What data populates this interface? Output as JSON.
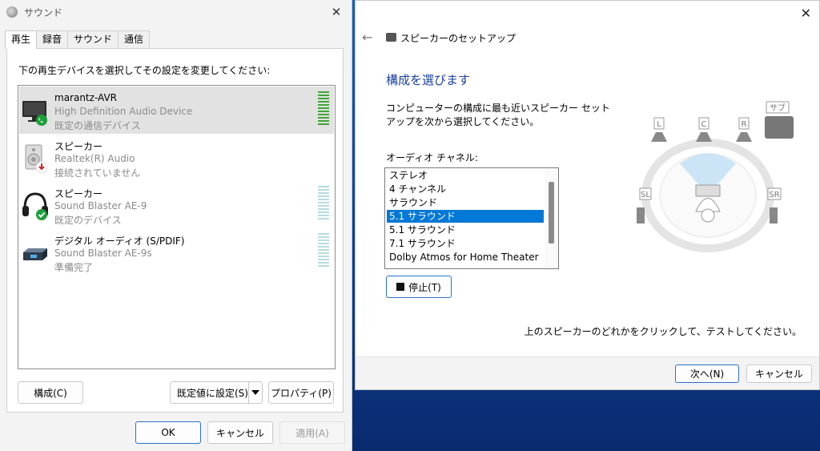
{
  "sound": {
    "title": "サウンド",
    "tabs": [
      "再生",
      "録音",
      "サウンド",
      "通信"
    ],
    "instruction": "下の再生デバイスを選択してその設定を変更してください:",
    "devices": [
      {
        "name": "marantz-AVR",
        "desc": "High Definition Audio Device",
        "status": "既定の通信デバイス"
      },
      {
        "name": "スピーカー",
        "desc": "Realtek(R) Audio",
        "status": "接続されていません"
      },
      {
        "name": "スピーカー",
        "desc": "Sound Blaster AE-9",
        "status": "既定のデバイス"
      },
      {
        "name": "デジタル オーディオ (S/PDIF)",
        "desc": "Sound Blaster AE-9s",
        "status": "準備完了"
      }
    ],
    "buttons": {
      "configure": "構成(C)",
      "set_default": "既定値に設定(S)",
      "properties": "プロパティ(P)",
      "ok": "OK",
      "cancel": "キャンセル",
      "apply": "適用(A)"
    }
  },
  "setup": {
    "title": "スピーカーのセットアップ",
    "heading": "構成を選びます",
    "description": "コンピューターの構成に最も近いスピーカー セットアップを次から選択してください。",
    "channel_label": "オーディオ チャネル:",
    "channels": [
      "ステレオ",
      "4 チャンネル",
      "サラウンド",
      "5.1 サラウンド",
      "5.1 サラウンド",
      "7.1 サラウンド",
      "Dolby Atmos for Home Theater"
    ],
    "selected_channel_index": 3,
    "stop_label": "停止(T)",
    "test_hint": "上のスピーカーのどれかをクリックして、テストしてください。",
    "next_label": "次へ(N)",
    "cancel_label": "キャンセル",
    "speaker_labels": {
      "left": "L",
      "center": "C",
      "right": "R",
      "sub": "サブ",
      "surround_left": "SL",
      "surround_right": "SR"
    }
  }
}
